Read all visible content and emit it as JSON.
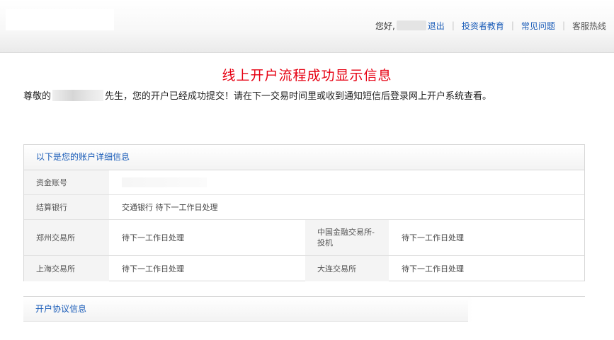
{
  "header": {
    "greeting": "您好,",
    "logout": "退出",
    "investor_edu": "投资者教育",
    "faq": "常见问题",
    "hotline": "客服热线",
    "link_color": "#1a5cb8"
  },
  "headline": "线上开户流程成功显示信息",
  "message": {
    "prefix": "尊敬的",
    "suffix": "先生，您的开户已经成功提交！请在下一交易时间里或收到通知短信后登录网上开户系统查看。"
  },
  "account_panel": {
    "title": "以下是您的账户详细信息",
    "rows": [
      {
        "label": "资金账号",
        "value": ""
      },
      {
        "label": "结算银行",
        "value": "交通银行 待下一工作日处理"
      },
      {
        "label": "郑州交易所",
        "value": "待下一工作日处理",
        "label2": "中国金融交易所-投机",
        "value2": "待下一工作日处理"
      },
      {
        "label": "上海交易所",
        "value": "待下一工作日处理",
        "label2": "大连交易所",
        "value2": "待下一工作日处理"
      }
    ]
  },
  "agreement_panel": {
    "title": "开户协议信息"
  },
  "colors": {
    "headline": "#e60012",
    "label_bg": "#f4f4f4"
  }
}
